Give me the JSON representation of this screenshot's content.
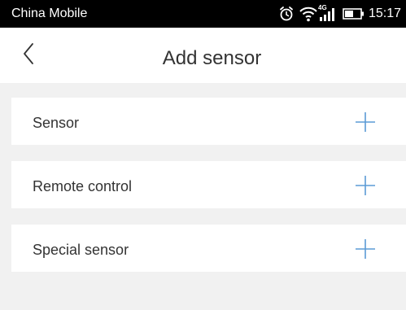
{
  "status_bar": {
    "carrier": "China Mobile",
    "network_label": "4G",
    "time": "15:17",
    "icons": [
      "alarm-icon",
      "wifi-icon",
      "signal-icon",
      "battery-icon"
    ]
  },
  "header": {
    "back_icon": "chevron-left-icon",
    "title": "Add sensor"
  },
  "items": [
    {
      "label": "Sensor",
      "action_icon": "plus-icon"
    },
    {
      "label": "Remote control",
      "action_icon": "plus-icon"
    },
    {
      "label": "Special sensor",
      "action_icon": "plus-icon"
    }
  ],
  "colors": {
    "status_bar_bg": "#000000",
    "background": "#f1f1f1",
    "surface": "#ffffff",
    "text": "#333333",
    "accent": "#5b9bd5"
  }
}
